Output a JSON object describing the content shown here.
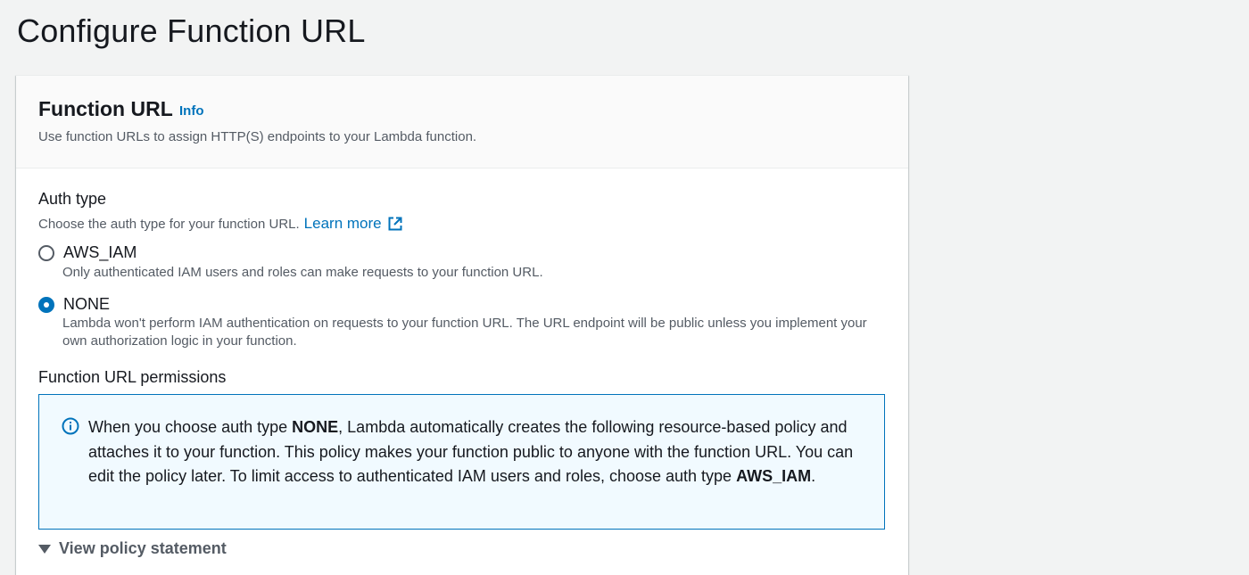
{
  "page": {
    "title": "Configure Function URL"
  },
  "panel": {
    "title": "Function URL",
    "info_link": "Info",
    "description": "Use function URLs to assign HTTP(S) endpoints to your Lambda function."
  },
  "auth_type": {
    "label": "Auth type",
    "description": "Choose the auth type for your function URL.",
    "learn_more": "Learn more",
    "options": [
      {
        "value": "AWS_IAM",
        "label": "AWS_IAM",
        "description": "Only authenticated IAM users and roles can make requests to your function URL.",
        "selected": false
      },
      {
        "value": "NONE",
        "label": "NONE",
        "description": "Lambda won't perform IAM authentication on requests to your function URL. The URL endpoint will be public unless you implement your own authorization logic in your function.",
        "selected": true
      }
    ]
  },
  "permissions": {
    "label": "Function URL permissions",
    "alert": {
      "part1": "When you choose auth type ",
      "bold1": "NONE",
      "part2": ", Lambda automatically creates the following resource-based policy and attaches it to your function. This policy makes your function public to anyone with the function URL. You can edit the policy later. To limit access to authenticated IAM users and roles, choose auth type ",
      "bold2": "AWS_IAM",
      "part3": "."
    },
    "view_policy": "View policy statement"
  },
  "colors": {
    "link": "#0073bb",
    "alert_bg": "#f1faff",
    "alert_border": "#0073bb",
    "page_bg": "#f2f3f3"
  },
  "icons": {
    "external": "external-link-icon",
    "info": "info-circle-icon",
    "caret": "caret-down-icon"
  }
}
